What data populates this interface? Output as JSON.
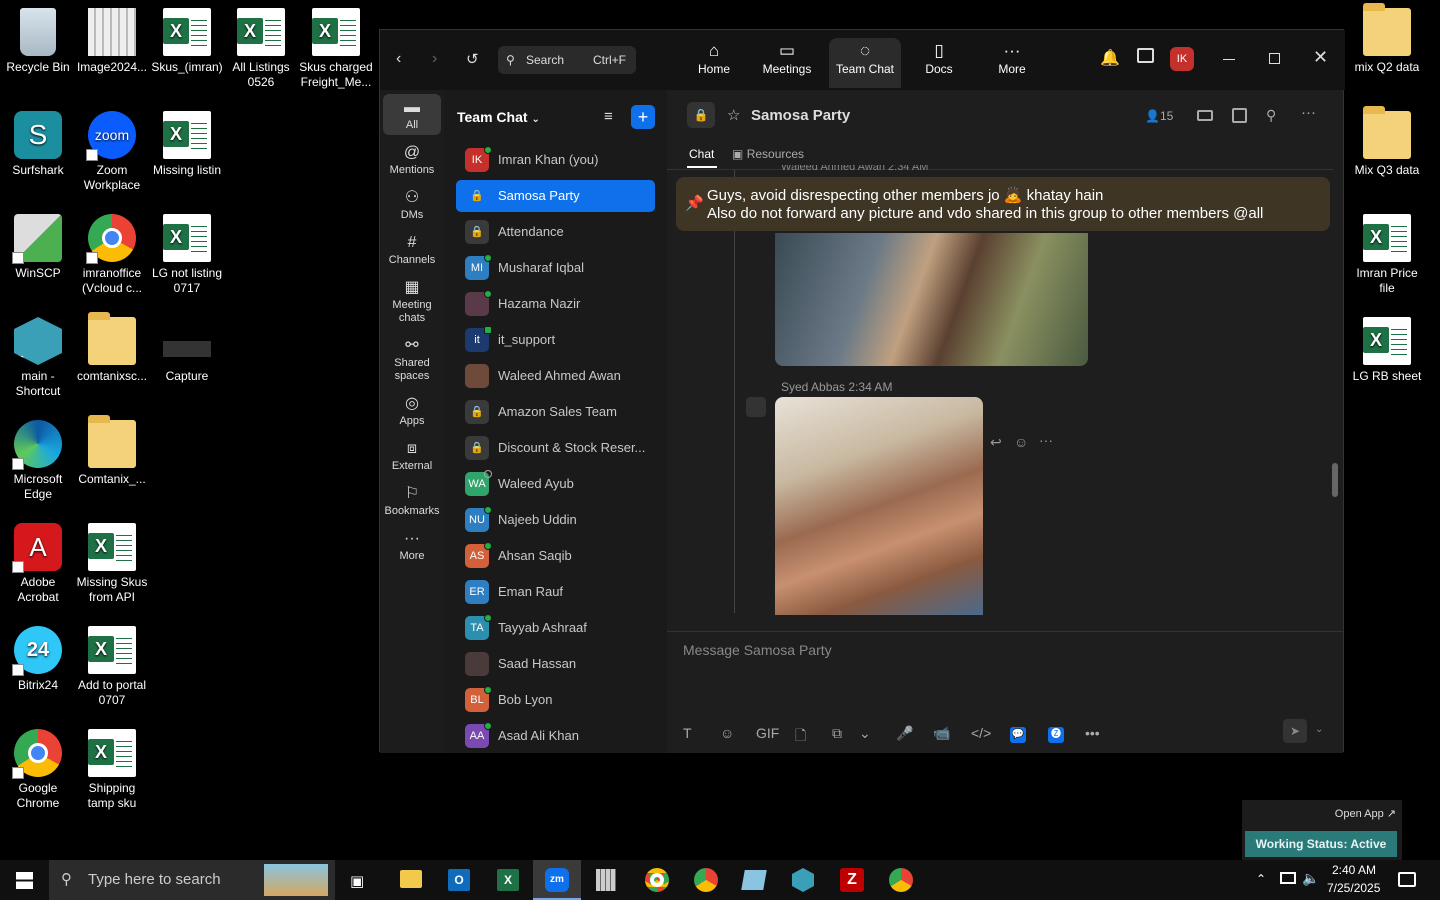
{
  "desktop": {
    "icons": [
      {
        "label": "Recycle Bin",
        "type": "bin"
      },
      {
        "label": "Image2024...",
        "type": "img"
      },
      {
        "label": "Skus_(imran)",
        "type": "xl"
      },
      {
        "label": "All Listings 0526",
        "type": "xl"
      },
      {
        "label": "Skus charged Freight_Me...",
        "type": "xl"
      },
      {
        "label": "Surfshark",
        "type": "surf"
      },
      {
        "label": "Zoom Workplace",
        "type": "zoom"
      },
      {
        "label": "Missing listin",
        "type": "xl"
      },
      {
        "label": "WinSCP",
        "type": "winscp"
      },
      {
        "label": "imranoffice (Vcloud c...",
        "type": "chrome"
      },
      {
        "label": "LG not listing 0717",
        "type": "xl"
      },
      {
        "label": "main - Shortcut",
        "type": "main"
      },
      {
        "label": "comtanixsc...",
        "type": "fold"
      },
      {
        "label": "Capture",
        "type": "cap"
      },
      {
        "label": "Microsoft Edge",
        "type": "edge"
      },
      {
        "label": "Comtanix_...",
        "type": "zip"
      },
      {
        "label": "Adobe Acrobat",
        "type": "acro"
      },
      {
        "label": "Missing Skus from API",
        "type": "xl"
      },
      {
        "label": "Bitrix24",
        "type": "bitrix"
      },
      {
        "label": "Add to portal 0707",
        "type": "xl"
      },
      {
        "label": "Google Chrome",
        "type": "chrome"
      },
      {
        "label": "Shipping tamp sku",
        "type": "xl"
      },
      {
        "label": "mix Q2 data",
        "type": "fold"
      },
      {
        "label": "Mix Q3 data",
        "type": "fold"
      },
      {
        "label": "Imran Price file",
        "type": "xl"
      },
      {
        "label": "LG RB sheet",
        "type": "xl"
      }
    ]
  },
  "zoom": {
    "search_label": "Search",
    "search_shortcut": "Ctrl+F",
    "nav": [
      {
        "label": "Home",
        "icon": "home-icon"
      },
      {
        "label": "Meetings",
        "icon": "video-icon"
      },
      {
        "label": "Team Chat",
        "icon": "chat-icon"
      },
      {
        "label": "Docs",
        "icon": "doc-icon"
      },
      {
        "label": "More",
        "icon": "more-icon"
      }
    ],
    "avatar": "IK",
    "rail": [
      {
        "label": "All",
        "icon": "chat-bubble-icon"
      },
      {
        "label": "Mentions",
        "icon": "at-icon"
      },
      {
        "label": "DMs",
        "icon": "people-icon"
      },
      {
        "label": "Channels",
        "icon": "hash-icon"
      },
      {
        "label": "Meeting chats",
        "icon": "calendar-icon"
      },
      {
        "label": "Shared spaces",
        "icon": "share-icon"
      },
      {
        "label": "Apps",
        "icon": "apps-icon"
      },
      {
        "label": "External",
        "icon": "external-icon"
      },
      {
        "label": "Bookmarks",
        "icon": "bookmark-icon"
      },
      {
        "label": "More",
        "icon": "more-icon"
      }
    ],
    "list_title": "Team Chat",
    "contacts": [
      {
        "name": "Imran Khan (you)",
        "av": "IK",
        "color": "#c4302b",
        "status": "online"
      },
      {
        "name": "Samosa Party",
        "av": "lock",
        "color": "#3a3a3a",
        "selected": true
      },
      {
        "name": "Attendance",
        "av": "lock",
        "color": "#3a3a3a"
      },
      {
        "name": "Musharaf Iqbal",
        "av": "MI",
        "color": "#2d7fc1",
        "status": "online"
      },
      {
        "name": "Hazama Nazir",
        "av": "",
        "color": "#5a3a48",
        "status": "online"
      },
      {
        "name": "it_support",
        "av": "it",
        "color": "#1c3a6e",
        "status": "mobile"
      },
      {
        "name": "Waleed Ahmed Awan",
        "av": "",
        "color": "#6e4a3a"
      },
      {
        "name": "Amazon Sales Team",
        "av": "lock",
        "color": "#3a3a3a"
      },
      {
        "name": "Discount & Stock Reser...",
        "av": "lock",
        "color": "#3a3a3a"
      },
      {
        "name": "Waleed Ayub",
        "av": "WA",
        "color": "#2fa46b",
        "status": "away"
      },
      {
        "name": "Najeeb Uddin",
        "av": "NU",
        "color": "#2d7fc1",
        "status": "online"
      },
      {
        "name": "Ahsan Saqib",
        "av": "AS",
        "color": "#d2603a",
        "status": "online"
      },
      {
        "name": "Eman Rauf",
        "av": "ER",
        "color": "#2d7fc1"
      },
      {
        "name": "Tayyab Ashraaf",
        "av": "TA",
        "color": "#2d8fb0",
        "status": "online"
      },
      {
        "name": "Saad Hassan",
        "av": "",
        "color": "#4a3a3a"
      },
      {
        "name": "Bob Lyon",
        "av": "BL",
        "color": "#d2603a",
        "status": "online"
      },
      {
        "name": "Asad Ali Khan",
        "av": "AA",
        "color": "#7a4ab0",
        "status": "online"
      }
    ],
    "channel": {
      "name": "Samosa Party",
      "members": "15",
      "tabs": [
        "Chat",
        "Resources"
      ]
    },
    "pinned": [
      "Guys, avoid disrespecting other members jo 🙇 khatay hain",
      "Also do not forward any picture and vdo shared in this group to other members @all"
    ],
    "cutoff_sender": "Waleed Ahmed Awan 2:34 AM",
    "message": {
      "sender": "Syed Abbas",
      "time": "2:34 AM"
    },
    "composer_placeholder": "Message Samosa Party",
    "composer_tools": [
      "T",
      "☺",
      "GIF",
      "🗋",
      "⧉",
      "⌄",
      "🎤",
      "📹",
      "</>",
      "💬",
      "🅩",
      "•••"
    ]
  },
  "panel": {
    "open_app": "Open App ↗",
    "status": "Working Status: Active"
  },
  "taskbar": {
    "search_placeholder": "Type here to search",
    "time": "2:40 AM",
    "date": "7/25/2025"
  }
}
